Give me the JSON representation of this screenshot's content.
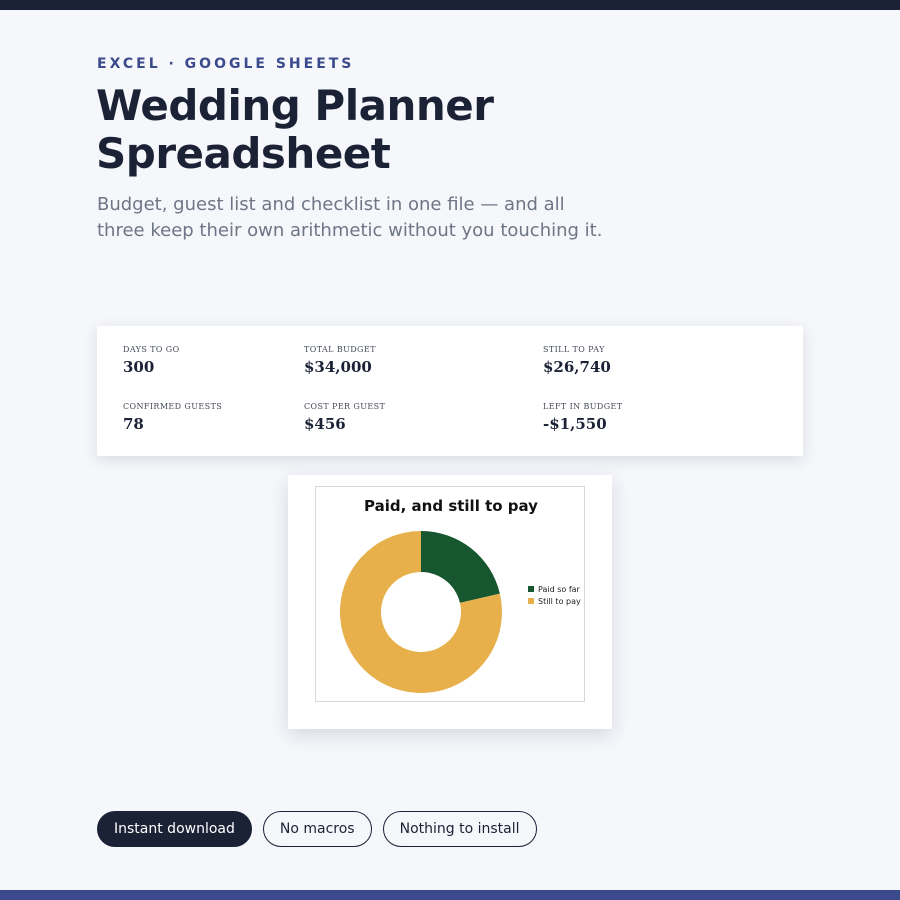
{
  "hero": {
    "eyebrow": "EXCEL · GOOGLE SHEETS",
    "title": "Wedding Planner Spreadsheet",
    "subtitle": "Budget, guest list and checklist in one file — and all three keep their own arithmetic without you touching it."
  },
  "kpis": [
    {
      "label": "DAYS TO GO",
      "value": "300"
    },
    {
      "label": "TOTAL BUDGET",
      "value": "$34,000"
    },
    {
      "label": "STILL TO PAY",
      "value": "$26,740"
    },
    {
      "label": "CONFIRMED GUESTS",
      "value": "78"
    },
    {
      "label": "COST PER GUEST",
      "value": "$456"
    },
    {
      "label": "LEFT IN BUDGET",
      "value": "-$1,550"
    }
  ],
  "chart_data": {
    "type": "pie",
    "title": "Paid, and still to pay",
    "categories": [
      "Paid so far",
      "Still to pay"
    ],
    "values": [
      7260,
      26740
    ],
    "colors": [
      "#17572f",
      "#e8b04b"
    ],
    "donut": true,
    "legend_position": "right"
  },
  "pills": [
    {
      "label": "Instant download"
    },
    {
      "label": "No macros"
    },
    {
      "label": "Nothing to install"
    }
  ],
  "colors": {
    "navy": "#1b2236",
    "accent": "#3b4a8c",
    "background": "#f5f7fb"
  }
}
